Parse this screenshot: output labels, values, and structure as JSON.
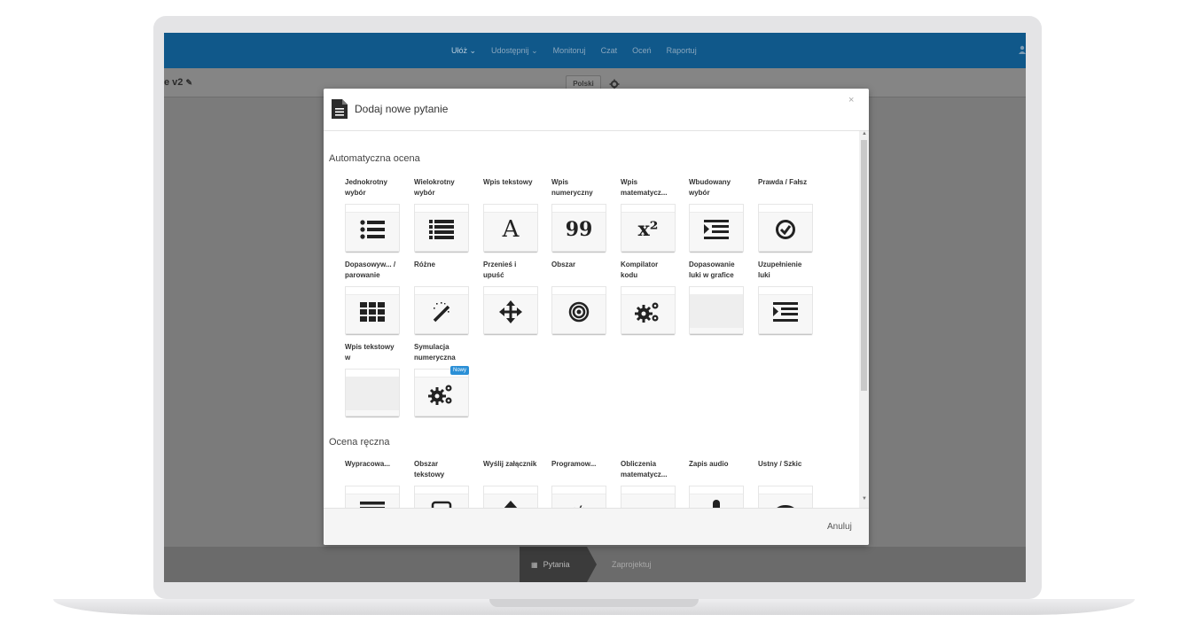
{
  "nav": {
    "items": [
      "Ułóż ⌄",
      "Udostępnij ⌄",
      "Monitoruj",
      "Czat",
      "Oceń",
      "Raportuj"
    ]
  },
  "doc": {
    "title": "e v2"
  },
  "lang": {
    "label": "Polski"
  },
  "modal": {
    "title": "Dodaj nowe pytanie",
    "close": "×",
    "cancel": "Anuluj",
    "sections": {
      "auto": "Automatyczna ocena",
      "manual": "Ocena ręczna"
    },
    "auto_items": [
      {
        "label": "Jednokrotny wybór",
        "icon": "list-bullets-icon"
      },
      {
        "label": "Wielokrotny wybór",
        "icon": "list-icon"
      },
      {
        "label": "Wpis tekstowy",
        "icon": "letter-a-icon"
      },
      {
        "label": "Wpis numeryczny",
        "icon": "number-99-icon"
      },
      {
        "label": "Wpis matematycz...",
        "icon": "x-squared-icon"
      },
      {
        "label": "Wbudowany wybór",
        "icon": "indent-icon"
      },
      {
        "label": "Prawda / Fałsz",
        "icon": "check-circle-icon"
      },
      {
        "label": "Dopasowyw... / parowanie",
        "icon": "grid-icon"
      },
      {
        "label": "Różne",
        "icon": "magic-wand-icon"
      },
      {
        "label": "Przenieś i upuść",
        "icon": "move-arrows-icon"
      },
      {
        "label": "Obszar",
        "icon": "target-icon"
      },
      {
        "label": "Kompilator kodu",
        "icon": "gears-icon"
      },
      {
        "label": "Dopasowanie luki w grafice",
        "icon": "blank-image-icon"
      },
      {
        "label": "Uzupełnienie luki",
        "icon": "indent-icon"
      },
      {
        "label": "Wpis tekstowy w",
        "icon": "blank-image-icon"
      },
      {
        "label": "Symulacja numeryczna",
        "icon": "gears-icon",
        "badge": "Nowy"
      }
    ],
    "manual_items": [
      {
        "label": "Wypracowa...",
        "icon": "paragraph-icon"
      },
      {
        "label": "Obszar tekstowy",
        "icon": "textbox-icon"
      },
      {
        "label": "Wyślij załącznik",
        "icon": "upload-icon"
      },
      {
        "label": "Programow...",
        "icon": "code-icon"
      },
      {
        "label": "Obliczenia matematycz...",
        "icon": "math-icon"
      },
      {
        "label": "Zapis audio",
        "icon": "microphone-icon"
      },
      {
        "label": "Ustny / Szkic",
        "icon": "speech-bubble-icon"
      }
    ]
  },
  "steps": {
    "step1": "Pytania",
    "step2": "Zaprojektuj"
  },
  "colors": {
    "topbar": "#10588a",
    "badge": "#2a8fd6",
    "overlay": "#7b7b7b"
  }
}
